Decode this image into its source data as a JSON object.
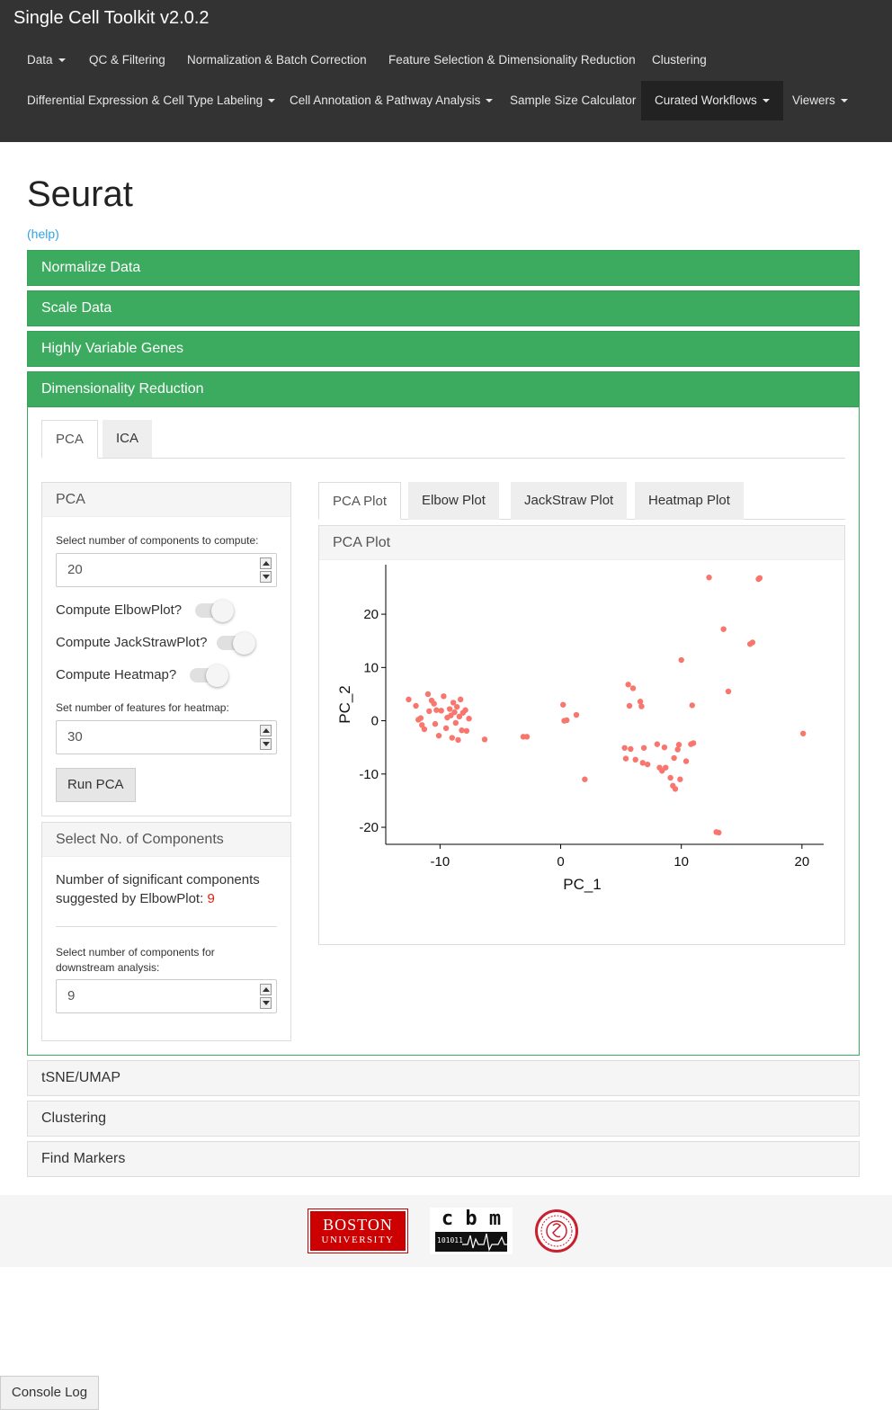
{
  "app": {
    "title": "Single Cell Toolkit v2.0.2"
  },
  "navbar": {
    "items": [
      {
        "label": "Data",
        "dropdown": true
      },
      {
        "label": "QC & Filtering",
        "dropdown": false
      },
      {
        "label": "Normalization & Batch Correction",
        "dropdown": false
      },
      {
        "label": "Feature Selection & Dimensionality Reduction",
        "dropdown": false
      },
      {
        "label": "Clustering",
        "dropdown": false
      },
      {
        "label": "Differential Expression & Cell Type Labeling",
        "dropdown": true
      },
      {
        "label": "Cell Annotation & Pathway Analysis",
        "dropdown": true
      },
      {
        "label": "Sample Size Calculator",
        "dropdown": false
      },
      {
        "label": "Curated Workflows",
        "dropdown": true,
        "active": true
      },
      {
        "label": "Viewers",
        "dropdown": true
      }
    ]
  },
  "page": {
    "title": "Seurat",
    "help": "(help)"
  },
  "sections": [
    {
      "label": "Normalize Data"
    },
    {
      "label": "Scale Data"
    },
    {
      "label": "Highly Variable Genes"
    },
    {
      "label": "Dimensionality Reduction"
    },
    {
      "label": "tSNE/UMAP"
    },
    {
      "label": "Clustering"
    },
    {
      "label": "Find Markers"
    }
  ],
  "dimred": {
    "tabs": [
      "PCA",
      "ICA"
    ],
    "pca_panel": {
      "title": "PCA",
      "components_label": "Select number of components to compute:",
      "components_value": "20",
      "elbow_label": "Compute ElbowPlot?",
      "jackstraw_label": "Compute JackStrawPlot?",
      "heatmap_label": "Compute Heatmap?",
      "features_label": "Set number of features for heatmap:",
      "features_value": "30",
      "run_button": "Run PCA"
    },
    "select_panel": {
      "title": "Select No. of Components",
      "text": "Number of significant components suggested by ElbowPlot:",
      "suggested": "9",
      "downstream_label_1": "Select number of components for",
      "downstream_label_2": "downstream analysis:",
      "downstream_value": "9"
    },
    "plot_tabs": [
      "PCA Plot",
      "Elbow Plot",
      "JackStraw Plot",
      "Heatmap Plot"
    ],
    "plot_title": "PCA Plot"
  },
  "footer": {
    "bu_line1": "BOSTON",
    "bu_line2": "UNIVERSITY",
    "cbm_letters": "c b m",
    "cbm_bits": "101011"
  },
  "console": {
    "label": "Console Log"
  },
  "colors": {
    "accent": "#3cab5f",
    "navbar": "#333333",
    "point": "#f8766d",
    "highlight": "#d9230f"
  },
  "chart_data": {
    "type": "scatter",
    "xlabel": "PC_1",
    "ylabel": "PC_2",
    "xlim": [
      -14.5,
      21.8
    ],
    "ylim": [
      -23.2,
      29.3
    ],
    "xticks": [
      -10,
      0,
      10,
      20
    ],
    "yticks": [
      -20,
      -10,
      0,
      10,
      20
    ],
    "grid": false,
    "points": [
      [
        -12.6,
        4.0
      ],
      [
        -12.0,
        2.8
      ],
      [
        -11.8,
        0.2
      ],
      [
        -11.6,
        0.5
      ],
      [
        -11.5,
        -0.8
      ],
      [
        -11.3,
        -1.6
      ],
      [
        -11.0,
        5.0
      ],
      [
        -10.9,
        1.8
      ],
      [
        -10.7,
        3.8
      ],
      [
        -10.5,
        3.2
      ],
      [
        -10.4,
        -0.6
      ],
      [
        -10.3,
        2.0
      ],
      [
        -10.1,
        -2.8
      ],
      [
        -9.9,
        1.9
      ],
      [
        -9.7,
        4.6
      ],
      [
        -9.5,
        -1.4
      ],
      [
        -9.4,
        0.6
      ],
      [
        -9.2,
        2.2
      ],
      [
        -9.1,
        1.0
      ],
      [
        -9.0,
        -3.2
      ],
      [
        -8.9,
        3.4
      ],
      [
        -8.8,
        1.6
      ],
      [
        -8.7,
        -0.4
      ],
      [
        -8.6,
        2.6
      ],
      [
        -8.5,
        -3.6
      ],
      [
        -8.4,
        0.8
      ],
      [
        -8.3,
        4.0
      ],
      [
        -8.2,
        -1.8
      ],
      [
        -8.1,
        1.5
      ],
      [
        -7.9,
        2.0
      ],
      [
        -7.8,
        -1.9
      ],
      [
        -7.6,
        0.4
      ],
      [
        -6.3,
        -3.5
      ],
      [
        -3.1,
        -3.0
      ],
      [
        -2.8,
        -3.0
      ],
      [
        0.2,
        3.0
      ],
      [
        0.3,
        0.0
      ],
      [
        0.5,
        0.1
      ],
      [
        1.3,
        1.1
      ],
      [
        2.0,
        -11.0
      ],
      [
        5.3,
        -5.1
      ],
      [
        5.4,
        -7.1
      ],
      [
        5.6,
        6.8
      ],
      [
        5.7,
        2.8
      ],
      [
        5.8,
        -5.3
      ],
      [
        6.0,
        6.1
      ],
      [
        6.2,
        -7.3
      ],
      [
        6.6,
        3.6
      ],
      [
        6.7,
        2.7
      ],
      [
        6.8,
        -7.9
      ],
      [
        6.9,
        -5.1
      ],
      [
        7.2,
        -8.2
      ],
      [
        8.0,
        -4.4
      ],
      [
        8.2,
        -8.8
      ],
      [
        8.4,
        -9.4
      ],
      [
        8.6,
        -5.0
      ],
      [
        8.7,
        -8.8
      ],
      [
        9.1,
        -10.7
      ],
      [
        9.3,
        -12.2
      ],
      [
        9.4,
        -7.0
      ],
      [
        9.5,
        -12.8
      ],
      [
        9.7,
        -5.4
      ],
      [
        9.8,
        -4.5
      ],
      [
        9.9,
        -11.0
      ],
      [
        10.0,
        11.4
      ],
      [
        10.4,
        -7.6
      ],
      [
        10.8,
        -4.4
      ],
      [
        10.9,
        2.9
      ],
      [
        11.0,
        -4.2
      ],
      [
        12.3,
        26.9
      ],
      [
        12.9,
        -20.9
      ],
      [
        13.1,
        -21.0
      ],
      [
        13.5,
        17.2
      ],
      [
        13.9,
        5.5
      ],
      [
        15.7,
        14.4
      ],
      [
        15.9,
        14.7
      ],
      [
        16.4,
        26.6
      ],
      [
        16.5,
        26.8
      ],
      [
        20.1,
        -2.4
      ]
    ]
  }
}
